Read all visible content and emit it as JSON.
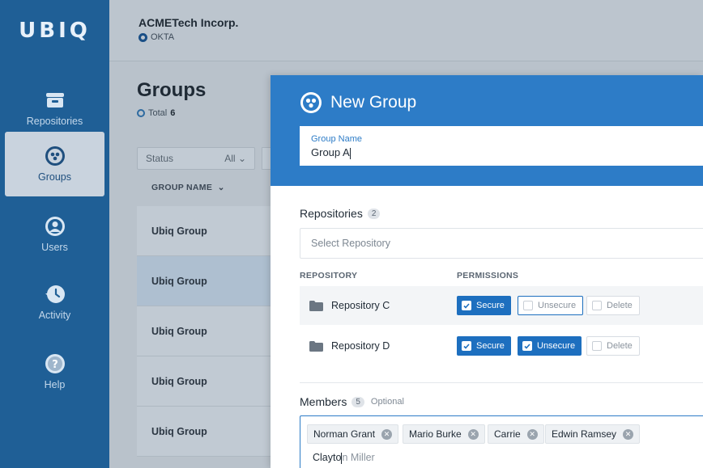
{
  "sidebar": {
    "logo": "UBIQ",
    "items": [
      {
        "label": "Repositories",
        "icon": "repository-icon"
      },
      {
        "label": "Groups",
        "icon": "groups-icon",
        "active": true
      },
      {
        "label": "Users",
        "icon": "user-icon"
      },
      {
        "label": "Activity",
        "icon": "history-icon"
      },
      {
        "label": "Help",
        "icon": "help-icon"
      }
    ]
  },
  "header": {
    "org_name": "ACMETech Incorp.",
    "org_provider": "OKTA"
  },
  "groups_page": {
    "title": "Groups",
    "total_label": "Total",
    "total_count": "6",
    "filter": {
      "label": "Status",
      "value": "All"
    },
    "column_header": "GROUP NAME",
    "rows": [
      "Ubiq Group",
      "Ubiq Group",
      "Ubiq Group",
      "Ubiq Group",
      "Ubiq Group"
    ]
  },
  "modal": {
    "title": "New Group",
    "group_name": {
      "label": "Group Name",
      "value": "Group A"
    },
    "repositories": {
      "title": "Repositories",
      "count": "2",
      "select_placeholder": "Select Repository",
      "col_repository": "REPOSITORY",
      "col_permissions": "PERMISSIONS",
      "items": [
        {
          "name": "Repository C",
          "secure": true,
          "unsecure": false,
          "delete": false
        },
        {
          "name": "Repository D",
          "secure": true,
          "unsecure": true,
          "delete": false
        }
      ],
      "perm_labels": {
        "secure": "Secure",
        "unsecure": "Unsecure",
        "delete": "Delete"
      }
    },
    "members": {
      "title": "Members",
      "count": "5",
      "optional_label": "Optional",
      "chips": [
        "Norman Grant",
        "Mario Burke",
        "Carrie",
        "Edwin Ramsey"
      ],
      "typed_text": "Clayto",
      "autocomplete_hint": "n Miller"
    }
  },
  "colors": {
    "sidebar": "#1f5f96",
    "modal_header": "#2d7cc7",
    "primary": "#1d6fbf"
  }
}
